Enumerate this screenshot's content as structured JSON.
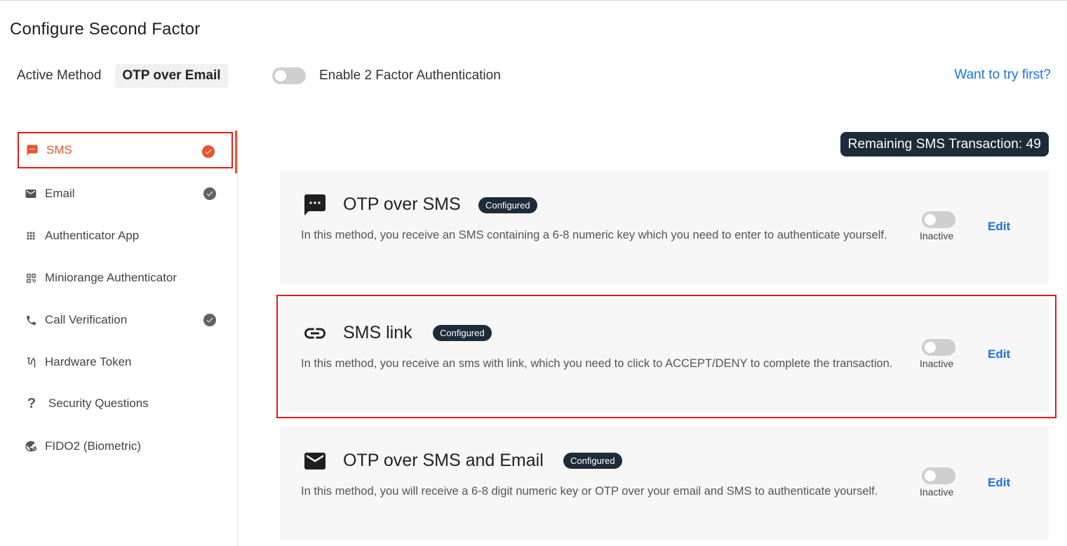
{
  "page": {
    "title": "Configure Second Factor"
  },
  "active_method": {
    "label": "Active Method",
    "value": "OTP over Email"
  },
  "two_factor_toggle": {
    "label": "Enable 2 Factor Authentication",
    "enabled": false
  },
  "try_link": "Want to try first?",
  "sidebar": {
    "items": [
      {
        "label": "SMS",
        "icon": "sms-icon",
        "checked": true,
        "active": true
      },
      {
        "label": "Email",
        "icon": "email-icon",
        "checked": true,
        "active": false
      },
      {
        "label": "Authenticator App",
        "icon": "grid-icon",
        "checked": false,
        "active": false
      },
      {
        "label": "Miniorange Authenticator",
        "icon": "qr-code-icon",
        "checked": false,
        "active": false
      },
      {
        "label": "Call Verification",
        "icon": "phone-icon",
        "checked": true,
        "active": false
      },
      {
        "label": "Hardware Token",
        "icon": "hardware-token-icon",
        "checked": false,
        "active": false
      },
      {
        "label": "Security Questions",
        "icon": "question-icon",
        "checked": false,
        "active": false
      },
      {
        "label": "FIDO2 (Biometric)",
        "icon": "fingerprint-globe-icon",
        "checked": false,
        "active": false
      }
    ]
  },
  "remaining_transactions": "Remaining SMS Transaction: 49",
  "methods": [
    {
      "title": "OTP over SMS",
      "icon": "sms-icon",
      "badge": "Configured",
      "description": "In this method, you receive an SMS containing a 6-8 numeric key which you need to enter to authenticate yourself.",
      "status": "Inactive",
      "edit_label": "Edit"
    },
    {
      "title": "SMS link",
      "icon": "link-icon",
      "badge": "Configured",
      "description": "In this method, you receive an sms with link, which you need to click to ACCEPT/DENY to complete the transaction.",
      "status": "Inactive",
      "edit_label": "Edit"
    },
    {
      "title": "OTP over SMS and Email",
      "icon": "email-icon",
      "badge": "Configured",
      "description": "In this method, you will receive a 6-8 digit numeric key or OTP over your email and SMS to authenticate yourself.",
      "status": "Inactive",
      "edit_label": "Edit"
    }
  ],
  "colors": {
    "accent": "#e8552a",
    "highlight": "#e01b1b",
    "link": "#1a73e8",
    "dark_badge": "#1e2b38",
    "card_bg": "#f7f7f7"
  }
}
